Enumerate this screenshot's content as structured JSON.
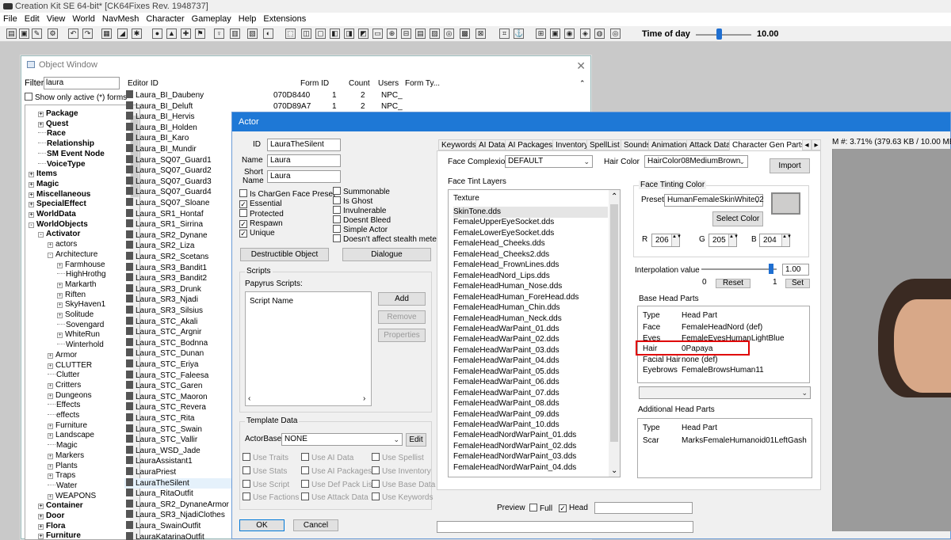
{
  "app": {
    "title": "Creation Kit SE 64-bit* [CK64Fixes Rev. 1948737]"
  },
  "menu": [
    "File",
    "Edit",
    "View",
    "World",
    "NavMesh",
    "Character",
    "Gameplay",
    "Help",
    "Extensions"
  ],
  "toolbar": {
    "time_of_day_label": "Time of day",
    "time_of_day_value": "10.00",
    "time_of_day_fraction": 0.42
  },
  "object_window": {
    "title": "Object Window",
    "filter_label": "Filter",
    "filter_value": "laura",
    "show_only_label": "Show only active (*) forms",
    "tree": [
      {
        "label": "Package",
        "indent": 1,
        "bold": true,
        "exp": "+"
      },
      {
        "label": "Quest",
        "indent": 1,
        "bold": true,
        "exp": "+"
      },
      {
        "label": "Race",
        "indent": 1,
        "bold": true,
        "exp": ""
      },
      {
        "label": "Relationship",
        "indent": 1,
        "bold": true,
        "exp": ""
      },
      {
        "label": "SM Event Node",
        "indent": 1,
        "bold": true,
        "exp": ""
      },
      {
        "label": "VoiceType",
        "indent": 1,
        "bold": true,
        "exp": ""
      },
      {
        "label": "Items",
        "indent": 0,
        "bold": true,
        "exp": "+"
      },
      {
        "label": "Magic",
        "indent": 0,
        "bold": true,
        "exp": "+"
      },
      {
        "label": "Miscellaneous",
        "indent": 0,
        "bold": true,
        "exp": "+"
      },
      {
        "label": "SpecialEffect",
        "indent": 0,
        "bold": true,
        "exp": "+"
      },
      {
        "label": "WorldData",
        "indent": 0,
        "bold": true,
        "exp": "+"
      },
      {
        "label": "WorldObjects",
        "indent": 0,
        "bold": true,
        "exp": "-"
      },
      {
        "label": "Activator",
        "indent": 1,
        "bold": true,
        "exp": "-"
      },
      {
        "label": "actors",
        "indent": 2,
        "bold": false,
        "exp": "+"
      },
      {
        "label": "Architecture",
        "indent": 2,
        "bold": false,
        "exp": "-"
      },
      {
        "label": "Farmhouse",
        "indent": 3,
        "bold": false,
        "exp": "+"
      },
      {
        "label": "HighHrothg",
        "indent": 3,
        "bold": false,
        "exp": ""
      },
      {
        "label": "Markarth",
        "indent": 3,
        "bold": false,
        "exp": "+"
      },
      {
        "label": "Riften",
        "indent": 3,
        "bold": false,
        "exp": "+"
      },
      {
        "label": "SkyHaven1",
        "indent": 3,
        "bold": false,
        "exp": "+"
      },
      {
        "label": "Solitude",
        "indent": 3,
        "bold": false,
        "exp": "+"
      },
      {
        "label": "Sovengard",
        "indent": 3,
        "bold": false,
        "exp": ""
      },
      {
        "label": "WhiteRun",
        "indent": 3,
        "bold": false,
        "exp": "+"
      },
      {
        "label": "Winterhold",
        "indent": 3,
        "bold": false,
        "exp": ""
      },
      {
        "label": "Armor",
        "indent": 2,
        "bold": false,
        "exp": "+"
      },
      {
        "label": "CLUTTER",
        "indent": 2,
        "bold": false,
        "exp": "+"
      },
      {
        "label": "Clutter",
        "indent": 2,
        "bold": false,
        "exp": ""
      },
      {
        "label": "Critters",
        "indent": 2,
        "bold": false,
        "exp": "+"
      },
      {
        "label": "Dungeons",
        "indent": 2,
        "bold": false,
        "exp": "+"
      },
      {
        "label": "Effects",
        "indent": 2,
        "bold": false,
        "exp": ""
      },
      {
        "label": "effects",
        "indent": 2,
        "bold": false,
        "exp": ""
      },
      {
        "label": "Furniture",
        "indent": 2,
        "bold": false,
        "exp": "+"
      },
      {
        "label": "Landscape",
        "indent": 2,
        "bold": false,
        "exp": "+"
      },
      {
        "label": "Magic",
        "indent": 2,
        "bold": false,
        "exp": ""
      },
      {
        "label": "Markers",
        "indent": 2,
        "bold": false,
        "exp": "+"
      },
      {
        "label": "Plants",
        "indent": 2,
        "bold": false,
        "exp": "+"
      },
      {
        "label": "Traps",
        "indent": 2,
        "bold": false,
        "exp": "+"
      },
      {
        "label": "Water",
        "indent": 2,
        "bold": false,
        "exp": ""
      },
      {
        "label": "WEAPONS",
        "indent": 2,
        "bold": false,
        "exp": "+"
      },
      {
        "label": "Container",
        "indent": 1,
        "bold": true,
        "exp": "+"
      },
      {
        "label": "Door",
        "indent": 1,
        "bold": true,
        "exp": "+"
      },
      {
        "label": "Flora",
        "indent": 1,
        "bold": true,
        "exp": "+"
      },
      {
        "label": "Furniture",
        "indent": 1,
        "bold": true,
        "exp": "+"
      }
    ],
    "columns": [
      "Editor ID",
      "Form ID",
      "Count",
      "Users",
      "Form Ty..."
    ],
    "rows": [
      {
        "id": "Laura_BI_Daubeny",
        "form": "070D8440",
        "count": "1",
        "users": "2",
        "type": "NPC_"
      },
      {
        "id": "Laura_BI_Deluft",
        "form": "070D89A7",
        "count": "1",
        "users": "2",
        "type": "NPC_"
      },
      {
        "id": "Laura_BI_Hervis"
      },
      {
        "id": "Laura_BI_Holden"
      },
      {
        "id": "Laura_BI_Karo"
      },
      {
        "id": "Laura_BI_Mundir"
      },
      {
        "id": "Laura_SQ07_Guard1"
      },
      {
        "id": "Laura_SQ07_Guard2"
      },
      {
        "id": "Laura_SQ07_Guard3"
      },
      {
        "id": "Laura_SQ07_Guard4"
      },
      {
        "id": "Laura_SQ07_Sloane"
      },
      {
        "id": "Laura_SR1_Hontaf"
      },
      {
        "id": "Laura_SR1_Sirrina"
      },
      {
        "id": "Laura_SR2_Dynane"
      },
      {
        "id": "Laura_SR2_Liza"
      },
      {
        "id": "Laura_SR2_Scetans"
      },
      {
        "id": "Laura_SR3_Bandit1"
      },
      {
        "id": "Laura_SR3_Bandit2"
      },
      {
        "id": "Laura_SR3_Drunk"
      },
      {
        "id": "Laura_SR3_Njadi"
      },
      {
        "id": "Laura_SR3_Silsius"
      },
      {
        "id": "Laura_STC_Akali"
      },
      {
        "id": "Laura_STC_Argnir"
      },
      {
        "id": "Laura_STC_Bodnna"
      },
      {
        "id": "Laura_STC_Dunan"
      },
      {
        "id": "Laura_STC_Eriya"
      },
      {
        "id": "Laura_STC_Faleesa"
      },
      {
        "id": "Laura_STC_Garen"
      },
      {
        "id": "Laura_STC_Maoron"
      },
      {
        "id": "Laura_STC_Revera"
      },
      {
        "id": "Laura_STC_Rita"
      },
      {
        "id": "Laura_STC_Swain"
      },
      {
        "id": "Laura_STC_Vallir"
      },
      {
        "id": "Laura_WSD_Jade"
      },
      {
        "id": "LauraAssistant1"
      },
      {
        "id": "LauraPriest"
      },
      {
        "id": "LauraTheSilent",
        "selected": true
      },
      {
        "id": "Laura_RitaOutfit"
      },
      {
        "id": "Laura_SR2_DynaneArmor"
      },
      {
        "id": "Laura_SR3_NjadiClothes"
      },
      {
        "id": "Laura_SwainOutfit"
      },
      {
        "id": "LauraKatarinaOutfit"
      }
    ]
  },
  "actor": {
    "title": "Actor",
    "id_label": "ID",
    "id_value": "LauraTheSilent",
    "name_label": "Name",
    "name_value": "Laura",
    "short_label_1": "Short",
    "short_label_2": "Name",
    "short_value": "Laura",
    "checks_left": [
      {
        "label": "Is CharGen Face Preset",
        "checked": false
      },
      {
        "label": "Essential",
        "checked": true
      },
      {
        "label": "Protected",
        "checked": false
      },
      {
        "label": "Respawn",
        "checked": true
      },
      {
        "label": "Unique",
        "checked": true
      }
    ],
    "checks_right": [
      {
        "label": "Summonable",
        "checked": false
      },
      {
        "label": "Is Ghost",
        "checked": false
      },
      {
        "label": "Invulnerable",
        "checked": false
      },
      {
        "label": "Doesnt Bleed",
        "checked": false
      },
      {
        "label": "Simple Actor",
        "checked": false
      },
      {
        "label": "Doesn't affect stealth meter",
        "checked": false
      }
    ],
    "destructible_button": "Destructible Object",
    "dialogue_button": "Dialogue",
    "scripts_group": "Scripts",
    "papyrus_label": "Papyrus Scripts:",
    "script_name_col": "Script Name",
    "add_button": "Add",
    "remove_button": "Remove",
    "properties_button": "Properties",
    "template_group": "Template Data",
    "actorbase_label": "ActorBase",
    "actorbase_value": "NONE",
    "edit_button": "Edit",
    "template_checks": [
      [
        "Use Traits",
        "Use AI Data",
        "Use Spellist"
      ],
      [
        "Use Stats",
        "Use AI Packages",
        "Use Inventory"
      ],
      [
        "Use Script",
        "Use Def Pack List",
        "Use Base Data"
      ],
      [
        "Use Factions",
        "Use Attack Data",
        "Use Keywords"
      ]
    ],
    "ok_button": "OK",
    "cancel_button": "Cancel",
    "tabs": [
      "Keywords",
      "AI Data",
      "AI Packages",
      "Inventory",
      "SpellList",
      "Sounds",
      "Animation",
      "Attack Data",
      "Character Gen Parts"
    ],
    "face_complexion_label": "Face Complexion",
    "face_complexion_value": "DEFAULT",
    "hair_color_label": "Hair Color",
    "hair_color_value": "HairColor08MediumBrown",
    "import_button": "Import",
    "face_tint_label": "Face Tint Layers",
    "texture_col": "Texture",
    "textures": [
      "SkinTone.dds",
      "FemaleUpperEyeSocket.dds",
      "FemaleLowerEyeSocket.dds",
      "FemaleHead_Cheeks.dds",
      "FemaleHead_Cheeks2.dds",
      "FemaleHead_FrownLines.dds",
      "FemaleHeadNord_Lips.dds",
      "FemaleHeadHuman_Nose.dds",
      "FemaleHeadHuman_ForeHead.dds",
      "FemaleHeadHuman_Chin.dds",
      "FemaleHeadHuman_Neck.dds",
      "FemaleHeadWarPaint_01.dds",
      "FemaleHeadWarPaint_02.dds",
      "FemaleHeadWarPaint_03.dds",
      "FemaleHeadWarPaint_04.dds",
      "FemaleHeadWarPaint_05.dds",
      "FemaleHeadWarPaint_06.dds",
      "FemaleHeadWarPaint_07.dds",
      "FemaleHeadWarPaint_08.dds",
      "FemaleHeadWarPaint_09.dds",
      "FemaleHeadWarPaint_10.dds",
      "FemaleHeadNordWarPaint_01.dds",
      "FemaleHeadNordWarPaint_02.dds",
      "FemaleHeadNordWarPaint_03.dds",
      "FemaleHeadNordWarPaint_04.dds"
    ],
    "face_tint_color_group": "Face Tinting Color",
    "preset_label": "Preset",
    "preset_value": "HumanFemaleSkinWhite02",
    "select_color_button": "Select Color",
    "r_label": "R",
    "r_value": "206",
    "g_label": "G",
    "g_value": "205",
    "b_label": "B",
    "b_value": "204",
    "interp_label": "Interpolation value",
    "interp_value": "1.00",
    "interp_min": "0",
    "interp_max": "1",
    "reset_button": "Reset",
    "set_button": "Set",
    "base_head_label": "Base Head Parts",
    "type_col": "Type",
    "head_part_col": "Head Part",
    "head_parts": [
      {
        "type": "Face",
        "part": "FemaleHeadNord (def)"
      },
      {
        "type": "Eyes",
        "part": "FemaleEyesHumanLightBlue"
      },
      {
        "type": "Hair",
        "part": "0Papaya"
      },
      {
        "type": "Facial Hair",
        "part": "none (def)"
      },
      {
        "type": "Eyebrows",
        "part": "FemaleBrowsHuman11"
      }
    ],
    "additional_head_label": "Additional Head Parts",
    "additional_parts": [
      {
        "type": "Scar",
        "part": "MarksFemaleHumanoid01LeftGash"
      }
    ],
    "preview_label": "Preview",
    "full_label": "Full",
    "head_label": "Head",
    "mem_text": "M #: 3.71% (379.63 KB / 10.00 MB)",
    "highlight_color": "#e00000",
    "title_color": "#1e78d6"
  }
}
